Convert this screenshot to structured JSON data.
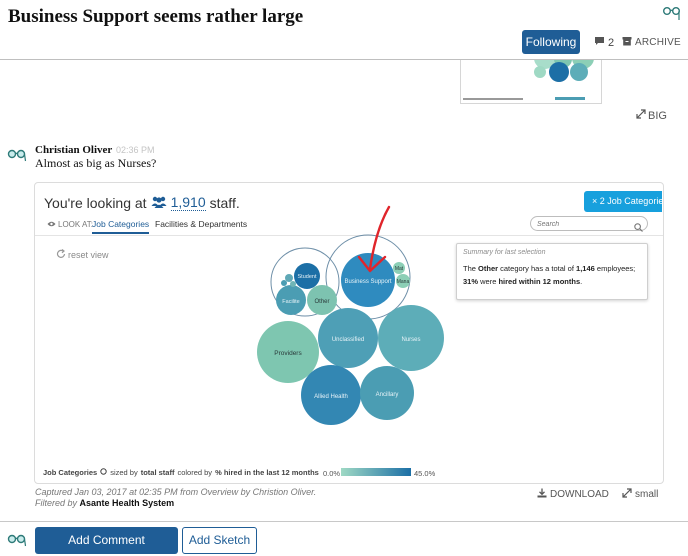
{
  "header": {
    "title": "Business Support seems rather large",
    "following_label": "Following",
    "comment_count": "2",
    "archive_label": "ARCHIVE"
  },
  "previous": {
    "big_label": "BIG"
  },
  "comment": {
    "author": "Christian Oliver",
    "time": "02:36 PM",
    "text": "Almost as big as Nurses?"
  },
  "snapshot": {
    "looking_prefix": "You're looking at",
    "staff_count": "1,910",
    "staff_suffix": "staff.",
    "badge_label": "2 Job Categories",
    "badge_close": "×",
    "look_at_label": "LOOK AT:",
    "tabs": [
      "Job Categories",
      "Facilities & Departments"
    ],
    "search_placeholder": "Search",
    "reset_label": "reset view",
    "bubbles": [
      {
        "label": "Business Support",
        "color": "#2f8bbf"
      },
      {
        "label": "Student",
        "color": "#1c6fa6"
      },
      {
        "label": "Facilite",
        "color": "#4b9db3"
      },
      {
        "label": "Other",
        "color": "#7dc3b0"
      },
      {
        "label": "Mat",
        "color": "#8ccfb6"
      },
      {
        "label": "Mana",
        "color": "#8ccfb6"
      },
      {
        "label": "Providers",
        "color": "#7ec6b0"
      },
      {
        "label": "Unclassified",
        "color": "#4e9fb6"
      },
      {
        "label": "Nurses",
        "color": "#5dadb8"
      },
      {
        "label": "Allied Health",
        "color": "#3387b3"
      },
      {
        "label": "Ancillary",
        "color": "#4b9db3"
      }
    ],
    "summary": {
      "title": "Summary for last selection",
      "line1_pre": "The",
      "line1_bold": "Other",
      "line1_mid": "category has a total of",
      "line1_count": "1,146",
      "line1_post": "employees;",
      "line2_pct": "31%",
      "line2_mid": "were",
      "line2_bold": "hired within 12 months",
      "line2_end": "."
    },
    "legend": {
      "category_label": "Job Categories",
      "sized_by": "sized by",
      "size_metric": "total staff",
      "colored_by": "colored by",
      "color_metric": "% hired in the last 12 months",
      "min": "0.0%",
      "max": "45.0%"
    }
  },
  "footer": {
    "captured": "Captured Jan 03, 2017 at 02:35 PM from Overview by Christion Oliver.",
    "filtered_label": "Filtered by",
    "filtered_value": "Asante Health System",
    "download_label": "DOWNLOAD",
    "small_label": "small"
  },
  "actions": {
    "add_comment": "Add Comment",
    "add_sketch": "Add Sketch"
  },
  "colors": {
    "accent": "#1f5d96",
    "badge": "#17a0dd",
    "sketch": "#e0252b"
  }
}
